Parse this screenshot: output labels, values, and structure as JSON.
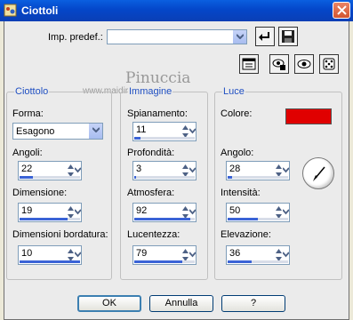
{
  "window": {
    "title": "Ciottoli"
  },
  "preset": {
    "label": "Imp. predef.:",
    "value": ""
  },
  "watermark": {
    "line1": "Pinuccia",
    "line2": "www.maidiregrafica.eu"
  },
  "groups": {
    "ciottolo": {
      "title": "Ciottolo",
      "forma_label": "Forma:",
      "forma_value": "Esagono",
      "angoli": {
        "label": "Angoli:",
        "value": "22",
        "fill": 0.22
      },
      "dimensione": {
        "label": "Dimensione:",
        "value": "19",
        "fill": 0.8
      },
      "dimensioni_bordatura": {
        "label": "Dimensioni bordatura:",
        "value": "10",
        "fill": 1.0
      }
    },
    "immagine": {
      "title": "Immagine",
      "spianamento": {
        "label": "Spianamento:",
        "value": "11",
        "fill": 0.11
      },
      "profondita": {
        "label": "Profondità:",
        "value": "3",
        "fill": 0.03
      },
      "atmosfera": {
        "label": "Atmosfera:",
        "value": "92",
        "fill": 0.92
      },
      "lucentezza": {
        "label": "Lucentezza:",
        "value": "79",
        "fill": 0.79
      }
    },
    "luce": {
      "title": "Luce",
      "colore_label": "Colore:",
      "color": "#e00000",
      "angolo": {
        "label": "Angolo:",
        "value": "28",
        "fill": 0.08
      },
      "intensita": {
        "label": "Intensità:",
        "value": "50",
        "fill": 0.5
      },
      "elevazione": {
        "label": "Elevazione:",
        "value": "36",
        "fill": 0.4
      }
    }
  },
  "buttons": {
    "ok": "OK",
    "cancel": "Annulla",
    "help": "?"
  }
}
